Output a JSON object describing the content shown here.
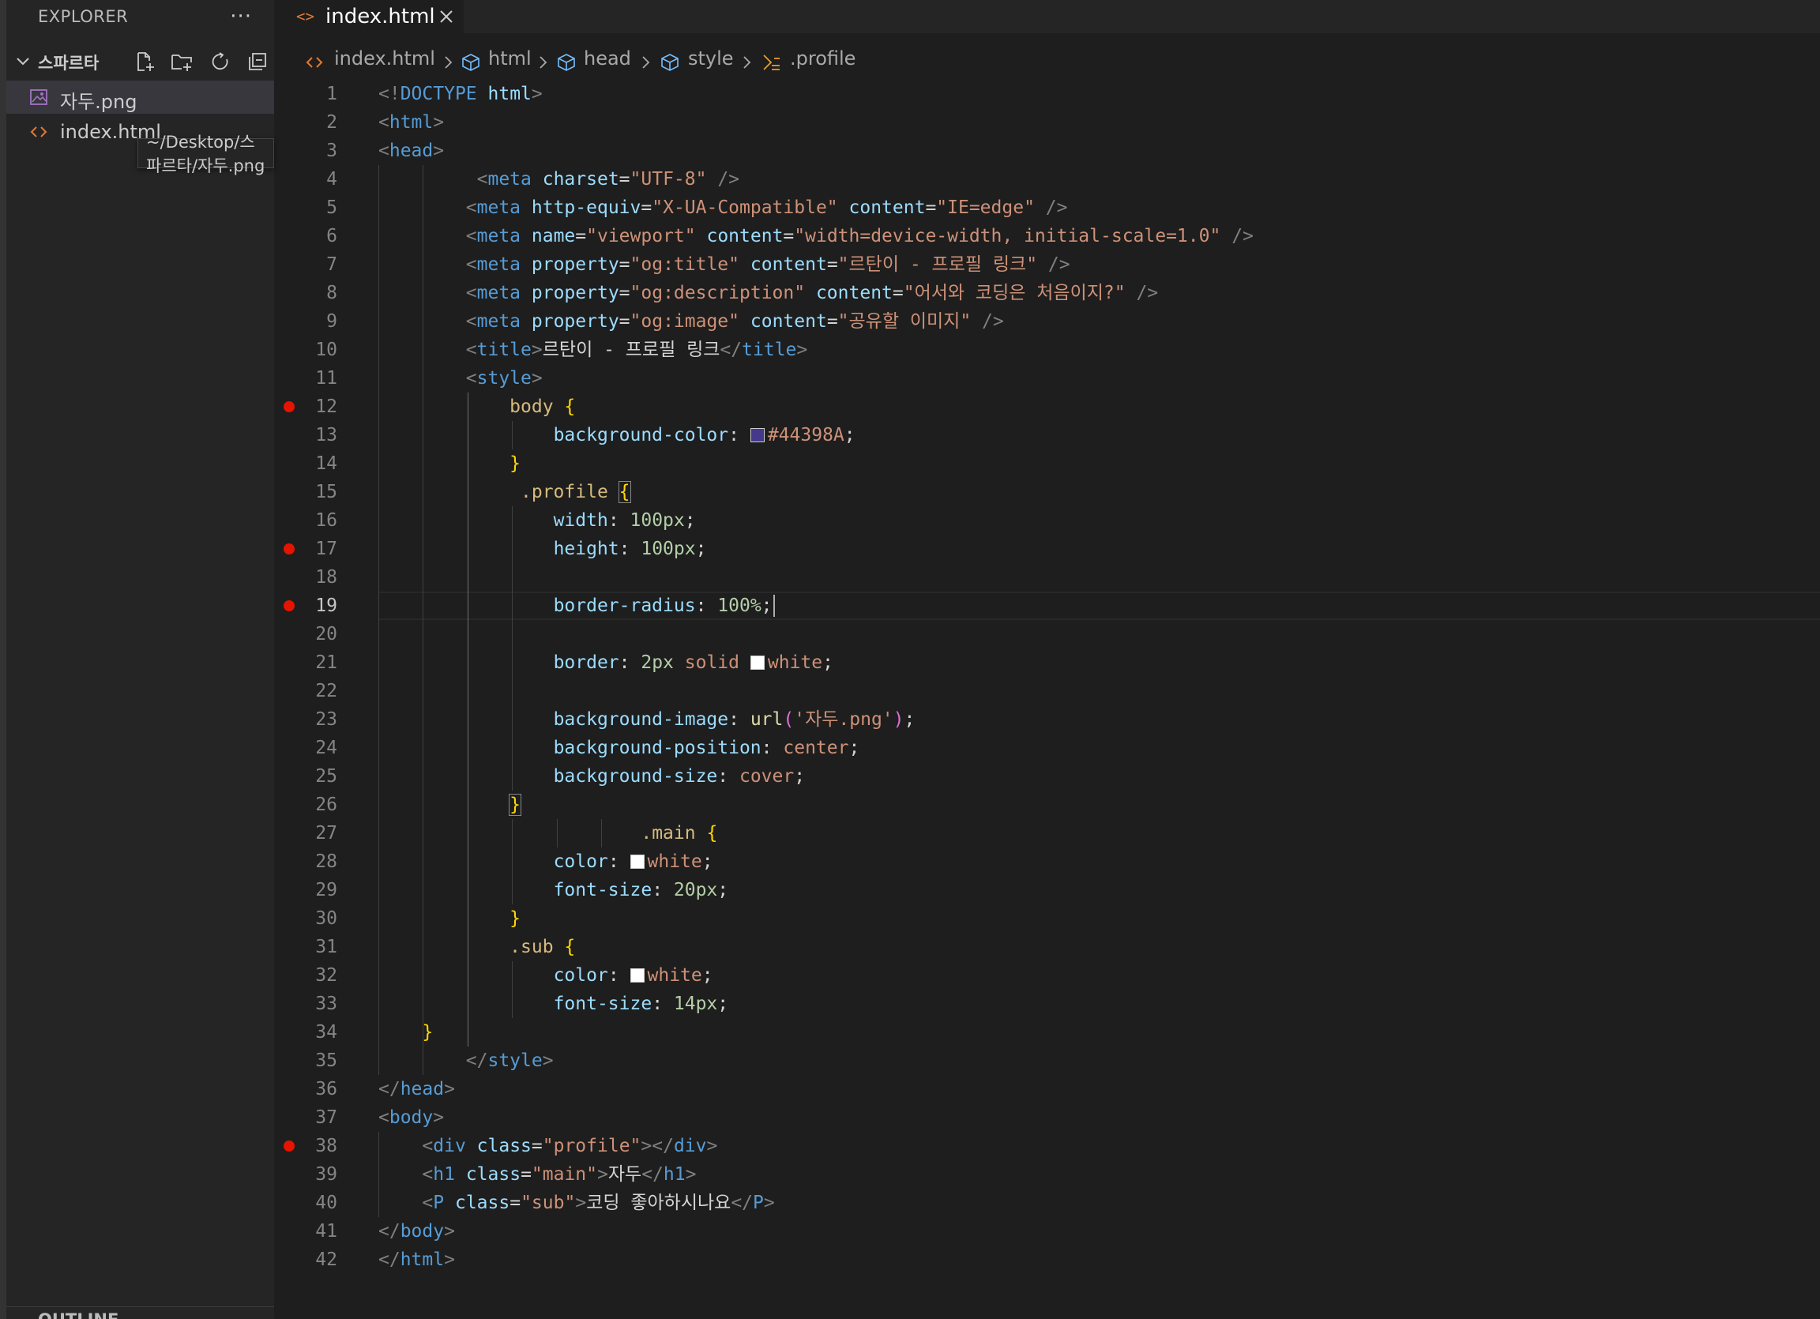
{
  "sidebar": {
    "title": "EXPLORER",
    "more_label": "···",
    "folder_name": "스파르타",
    "files": [
      {
        "name": "자두.png",
        "type": "image"
      },
      {
        "name": "index.html",
        "type": "html"
      }
    ],
    "tooltip": "~/Desktop/스파르타/자두.png",
    "outline_label": "OUTLINE"
  },
  "tab": {
    "icon": "<>",
    "label": "index.html"
  },
  "breadcrumb": [
    {
      "label": "index.html",
      "icon": "html-file-icon"
    },
    {
      "label": "html",
      "icon": "symbol-element-icon"
    },
    {
      "label": "head",
      "icon": "symbol-element-icon"
    },
    {
      "label": "style",
      "icon": "symbol-element-icon"
    },
    {
      "label": ".profile",
      "icon": "symbol-selector-icon"
    }
  ],
  "colors": {
    "body_bg_swatch": "#44398A",
    "white_swatch": "#ffffff",
    "breakpoint": "#e51400"
  },
  "editor": {
    "current_line": 19,
    "breakpoints": [
      12,
      17,
      19,
      38
    ],
    "lines": [
      [
        [
          "t-br",
          "<!"
        ],
        [
          "t-tag",
          "DOCTYPE"
        ],
        [
          "t-txt",
          " "
        ],
        [
          "t-attr",
          "html"
        ],
        [
          "t-br",
          ">"
        ]
      ],
      [
        [
          "t-br",
          "<"
        ],
        [
          "t-tag",
          "html"
        ],
        [
          "t-br",
          ">"
        ]
      ],
      [
        [
          "t-br",
          "<"
        ],
        [
          "t-tag",
          "head"
        ],
        [
          "t-br",
          ">"
        ]
      ],
      [
        [
          "t-txt",
          "         "
        ],
        [
          "t-br",
          "<"
        ],
        [
          "t-tag",
          "meta"
        ],
        [
          "t-txt",
          " "
        ],
        [
          "t-attr",
          "charset"
        ],
        [
          "t-txt",
          "="
        ],
        [
          "t-str",
          "\"UTF-8\""
        ],
        [
          "t-txt",
          " "
        ],
        [
          "t-br",
          "/>"
        ]
      ],
      [
        [
          "t-txt",
          "        "
        ],
        [
          "t-br",
          "<"
        ],
        [
          "t-tag",
          "meta"
        ],
        [
          "t-txt",
          " "
        ],
        [
          "t-attr",
          "http-equiv"
        ],
        [
          "t-txt",
          "="
        ],
        [
          "t-str",
          "\"X-UA-Compatible\""
        ],
        [
          "t-txt",
          " "
        ],
        [
          "t-attr",
          "content"
        ],
        [
          "t-txt",
          "="
        ],
        [
          "t-str",
          "\"IE=edge\""
        ],
        [
          "t-txt",
          " "
        ],
        [
          "t-br",
          "/>"
        ]
      ],
      [
        [
          "t-txt",
          "        "
        ],
        [
          "t-br",
          "<"
        ],
        [
          "t-tag",
          "meta"
        ],
        [
          "t-txt",
          " "
        ],
        [
          "t-attr",
          "name"
        ],
        [
          "t-txt",
          "="
        ],
        [
          "t-str",
          "\"viewport\""
        ],
        [
          "t-txt",
          " "
        ],
        [
          "t-attr",
          "content"
        ],
        [
          "t-txt",
          "="
        ],
        [
          "t-str",
          "\"width=device-width, initial-scale=1.0\""
        ],
        [
          "t-txt",
          " "
        ],
        [
          "t-br",
          "/>"
        ]
      ],
      [
        [
          "t-txt",
          "        "
        ],
        [
          "t-br",
          "<"
        ],
        [
          "t-tag",
          "meta"
        ],
        [
          "t-txt",
          " "
        ],
        [
          "t-attr",
          "property"
        ],
        [
          "t-txt",
          "="
        ],
        [
          "t-str",
          "\"og:title\""
        ],
        [
          "t-txt",
          " "
        ],
        [
          "t-attr",
          "content"
        ],
        [
          "t-txt",
          "="
        ],
        [
          "t-str",
          "\"르탄이 - 프로필 링크\""
        ],
        [
          "t-txt",
          " "
        ],
        [
          "t-br",
          "/>"
        ]
      ],
      [
        [
          "t-txt",
          "        "
        ],
        [
          "t-br",
          "<"
        ],
        [
          "t-tag",
          "meta"
        ],
        [
          "t-txt",
          " "
        ],
        [
          "t-attr",
          "property"
        ],
        [
          "t-txt",
          "="
        ],
        [
          "t-str",
          "\"og:description\""
        ],
        [
          "t-txt",
          " "
        ],
        [
          "t-attr",
          "content"
        ],
        [
          "t-txt",
          "="
        ],
        [
          "t-str",
          "\"어서와 코딩은 처음이지?\""
        ],
        [
          "t-txt",
          " "
        ],
        [
          "t-br",
          "/>"
        ]
      ],
      [
        [
          "t-txt",
          "        "
        ],
        [
          "t-br",
          "<"
        ],
        [
          "t-tag",
          "meta"
        ],
        [
          "t-txt",
          " "
        ],
        [
          "t-attr",
          "property"
        ],
        [
          "t-txt",
          "="
        ],
        [
          "t-str",
          "\"og:image\""
        ],
        [
          "t-txt",
          " "
        ],
        [
          "t-attr",
          "content"
        ],
        [
          "t-txt",
          "="
        ],
        [
          "t-str",
          "\"공유할 이미지\""
        ],
        [
          "t-txt",
          " "
        ],
        [
          "t-br",
          "/>"
        ]
      ],
      [
        [
          "t-txt",
          "        "
        ],
        [
          "t-br",
          "<"
        ],
        [
          "t-tag",
          "title"
        ],
        [
          "t-br",
          ">"
        ],
        [
          "t-txt",
          "르탄이 - 프로필 링크"
        ],
        [
          "t-br",
          "</"
        ],
        [
          "t-tag",
          "title"
        ],
        [
          "t-br",
          ">"
        ]
      ],
      [
        [
          "t-txt",
          "        "
        ],
        [
          "t-br",
          "<"
        ],
        [
          "t-tag",
          "style"
        ],
        [
          "t-br",
          ">"
        ]
      ],
      [
        [
          "t-txt",
          "            "
        ],
        [
          "t-sel",
          "body"
        ],
        [
          "t-txt",
          " "
        ],
        [
          "t-brace",
          "{"
        ]
      ],
      [
        [
          "t-txt",
          "                "
        ],
        [
          "t-prop",
          "background-color"
        ],
        [
          "t-txt",
          ": "
        ],
        [
          "swatch",
          "#44398A"
        ],
        [
          "t-val",
          "#44398A"
        ],
        [
          "t-txt",
          ";"
        ]
      ],
      [
        [
          "t-txt",
          "            "
        ],
        [
          "t-brace",
          "}"
        ]
      ],
      [
        [
          "t-txt",
          "             "
        ],
        [
          "t-sel",
          ".profile"
        ],
        [
          "t-txt",
          " "
        ],
        [
          "t-brace bracket-match",
          "{"
        ]
      ],
      [
        [
          "t-txt",
          "                "
        ],
        [
          "t-prop",
          "width"
        ],
        [
          "t-txt",
          ": "
        ],
        [
          "t-num",
          "100px"
        ],
        [
          "t-txt",
          ";"
        ]
      ],
      [
        [
          "t-txt",
          "                "
        ],
        [
          "t-prop",
          "height"
        ],
        [
          "t-txt",
          ": "
        ],
        [
          "t-num",
          "100px"
        ],
        [
          "t-txt",
          ";"
        ]
      ],
      [],
      [
        [
          "t-txt",
          "                "
        ],
        [
          "t-prop",
          "border-radius"
        ],
        [
          "t-txt",
          ": "
        ],
        [
          "t-num",
          "100%"
        ],
        [
          "t-txt",
          ";"
        ]
      ],
      [],
      [
        [
          "t-txt",
          "                "
        ],
        [
          "t-prop",
          "border"
        ],
        [
          "t-txt",
          ": "
        ],
        [
          "t-num",
          "2px"
        ],
        [
          "t-txt",
          " "
        ],
        [
          "t-val",
          "solid"
        ],
        [
          "t-txt",
          " "
        ],
        [
          "swatch",
          "#ffffff"
        ],
        [
          "t-val",
          "white"
        ],
        [
          "t-txt",
          ";"
        ]
      ],
      [],
      [
        [
          "t-txt",
          "                "
        ],
        [
          "t-prop",
          "background-image"
        ],
        [
          "t-txt",
          ": "
        ],
        [
          "t-fn",
          "url"
        ],
        [
          "t-paren",
          "("
        ],
        [
          "t-str",
          "'자두.png'"
        ],
        [
          "t-paren",
          ")"
        ],
        [
          "t-txt",
          ";"
        ]
      ],
      [
        [
          "t-txt",
          "                "
        ],
        [
          "t-prop",
          "background-position"
        ],
        [
          "t-txt",
          ": "
        ],
        [
          "t-val",
          "center"
        ],
        [
          "t-txt",
          ";"
        ]
      ],
      [
        [
          "t-txt",
          "                "
        ],
        [
          "t-prop",
          "background-size"
        ],
        [
          "t-txt",
          ": "
        ],
        [
          "t-val",
          "cover"
        ],
        [
          "t-txt",
          ";"
        ]
      ],
      [
        [
          "t-txt",
          "            "
        ],
        [
          "t-brace bracket-match",
          "}"
        ]
      ],
      [
        [
          "t-txt",
          "                        "
        ],
        [
          "t-sel",
          ".main"
        ],
        [
          "t-txt",
          " "
        ],
        [
          "t-brace",
          "{"
        ]
      ],
      [
        [
          "t-txt",
          "                "
        ],
        [
          "t-prop",
          "color"
        ],
        [
          "t-txt",
          ": "
        ],
        [
          "swatch",
          "#ffffff"
        ],
        [
          "t-val",
          "white"
        ],
        [
          "t-txt",
          ";"
        ]
      ],
      [
        [
          "t-txt",
          "                "
        ],
        [
          "t-prop",
          "font-size"
        ],
        [
          "t-txt",
          ": "
        ],
        [
          "t-num",
          "20px"
        ],
        [
          "t-txt",
          ";"
        ]
      ],
      [
        [
          "t-txt",
          "            "
        ],
        [
          "t-brace",
          "}"
        ]
      ],
      [
        [
          "t-txt",
          "            "
        ],
        [
          "t-sel",
          ".sub"
        ],
        [
          "t-txt",
          " "
        ],
        [
          "t-brace",
          "{"
        ]
      ],
      [
        [
          "t-txt",
          "                "
        ],
        [
          "t-prop",
          "color"
        ],
        [
          "t-txt",
          ": "
        ],
        [
          "swatch",
          "#ffffff"
        ],
        [
          "t-val",
          "white"
        ],
        [
          "t-txt",
          ";"
        ]
      ],
      [
        [
          "t-txt",
          "                "
        ],
        [
          "t-prop",
          "font-size"
        ],
        [
          "t-txt",
          ": "
        ],
        [
          "t-num",
          "14px"
        ],
        [
          "t-txt",
          ";"
        ]
      ],
      [
        [
          "t-txt",
          "    "
        ],
        [
          "t-brace",
          "}"
        ]
      ],
      [
        [
          "t-txt",
          "        "
        ],
        [
          "t-br",
          "</"
        ],
        [
          "t-tag",
          "style"
        ],
        [
          "t-br",
          ">"
        ]
      ],
      [
        [
          "t-br",
          "</"
        ],
        [
          "t-tag",
          "head"
        ],
        [
          "t-br",
          ">"
        ]
      ],
      [
        [
          "t-br",
          "<"
        ],
        [
          "t-tag",
          "body"
        ],
        [
          "t-br",
          ">"
        ]
      ],
      [
        [
          "t-txt",
          "    "
        ],
        [
          "t-br",
          "<"
        ],
        [
          "t-tag",
          "div"
        ],
        [
          "t-txt",
          " "
        ],
        [
          "t-attr",
          "class"
        ],
        [
          "t-txt",
          "="
        ],
        [
          "t-str",
          "\"profile\""
        ],
        [
          "t-br",
          "></"
        ],
        [
          "t-tag",
          "div"
        ],
        [
          "t-br",
          ">"
        ]
      ],
      [
        [
          "t-txt",
          "    "
        ],
        [
          "t-br",
          "<"
        ],
        [
          "t-tag",
          "h1"
        ],
        [
          "t-txt",
          " "
        ],
        [
          "t-attr",
          "class"
        ],
        [
          "t-txt",
          "="
        ],
        [
          "t-str",
          "\"main\""
        ],
        [
          "t-br",
          ">"
        ],
        [
          "t-txt",
          "자두"
        ],
        [
          "t-br",
          "</"
        ],
        [
          "t-tag",
          "h1"
        ],
        [
          "t-br",
          ">"
        ]
      ],
      [
        [
          "t-txt",
          "    "
        ],
        [
          "t-br",
          "<"
        ],
        [
          "t-tag",
          "P"
        ],
        [
          "t-txt",
          " "
        ],
        [
          "t-attr",
          "class"
        ],
        [
          "t-txt",
          "="
        ],
        [
          "t-str",
          "\"sub\""
        ],
        [
          "t-br",
          ">"
        ],
        [
          "t-txt",
          "코딩 좋아하시나요"
        ],
        [
          "t-br",
          "</"
        ],
        [
          "t-tag",
          "P"
        ],
        [
          "t-br",
          ">"
        ]
      ],
      [
        [
          "t-br",
          "</"
        ],
        [
          "t-tag",
          "body"
        ],
        [
          "t-br",
          ">"
        ]
      ],
      [
        [
          "t-br",
          "</"
        ],
        [
          "t-tag",
          "html"
        ],
        [
          "t-br",
          ">"
        ]
      ]
    ]
  }
}
